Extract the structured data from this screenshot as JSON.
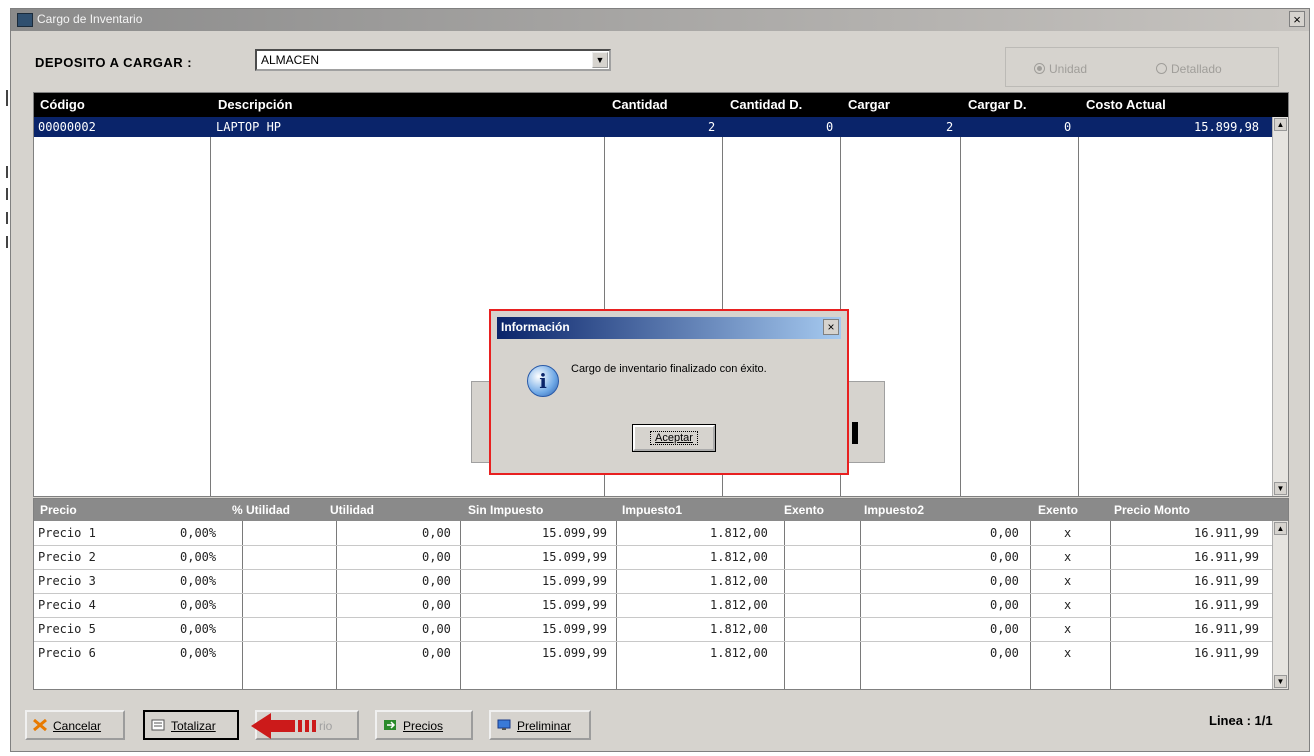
{
  "window": {
    "title": "Cargo de Inventario",
    "close_label": "×"
  },
  "deposit": {
    "label": "DEPOSITO A CARGAR :",
    "value": "ALMACEN",
    "options": {
      "unidad": "Unidad",
      "detallado": "Detallado",
      "selected": "Unidad"
    }
  },
  "grid_top": {
    "columns": [
      "Código",
      "Descripción",
      "Cantidad",
      "Cantidad D.",
      "Cargar",
      "Cargar D.",
      "Costo Actual"
    ],
    "rows": [
      {
        "codigo": "00000002",
        "descripcion": "LAPTOP HP",
        "cantidad": "2",
        "cantidad_d": "0",
        "cargar": "2",
        "cargar_d": "0",
        "costo": "15.899,98"
      }
    ]
  },
  "grid_prices": {
    "columns": [
      "Precio",
      "% Utilidad",
      "Utilidad",
      "Sin Impuesto",
      "Impuesto1",
      "Exento",
      "Impuesto2",
      "Exento",
      "Precio Monto"
    ],
    "rows": [
      {
        "precio": "Precio 1",
        "pct": "0,00%",
        "utilidad": "0,00",
        "sin_imp": "15.099,99",
        "imp1": "1.812,00",
        "imp2": "0,00",
        "exento": "x",
        "monto": "16.911,99"
      },
      {
        "precio": "Precio 2",
        "pct": "0,00%",
        "utilidad": "0,00",
        "sin_imp": "15.099,99",
        "imp1": "1.812,00",
        "imp2": "0,00",
        "exento": "x",
        "monto": "16.911,99"
      },
      {
        "precio": "Precio 3",
        "pct": "0,00%",
        "utilidad": "0,00",
        "sin_imp": "15.099,99",
        "imp1": "1.812,00",
        "imp2": "0,00",
        "exento": "x",
        "monto": "16.911,99"
      },
      {
        "precio": "Precio 4",
        "pct": "0,00%",
        "utilidad": "0,00",
        "sin_imp": "15.099,99",
        "imp1": "1.812,00",
        "imp2": "0,00",
        "exento": "x",
        "monto": "16.911,99"
      },
      {
        "precio": "Precio 5",
        "pct": "0,00%",
        "utilidad": "0,00",
        "sin_imp": "15.099,99",
        "imp1": "1.812,00",
        "imp2": "0,00",
        "exento": "x",
        "monto": "16.911,99"
      },
      {
        "precio": "Precio 6",
        "pct": "0,00%",
        "utilidad": "0,00",
        "sin_imp": "15.099,99",
        "imp1": "1.812,00",
        "imp2": "0,00",
        "exento": "x",
        "monto": "16.911,99"
      }
    ]
  },
  "buttons": {
    "cancelar": "Cancelar",
    "totalizar": "Totalizar",
    "hidden_partial": "rio",
    "precios": "Precios",
    "preliminar": "Preliminar"
  },
  "status": {
    "linea": "Linea : 1/1"
  },
  "dialog": {
    "title": "Información",
    "message": "Cargo de inventario finalizado con éxito.",
    "ok_label": "Aceptar",
    "close_label": "×",
    "icon": "info-icon"
  },
  "colors": {
    "selection": "#0a246a",
    "highlight_border": "#e82020",
    "arrow": "#cc1a1a"
  }
}
